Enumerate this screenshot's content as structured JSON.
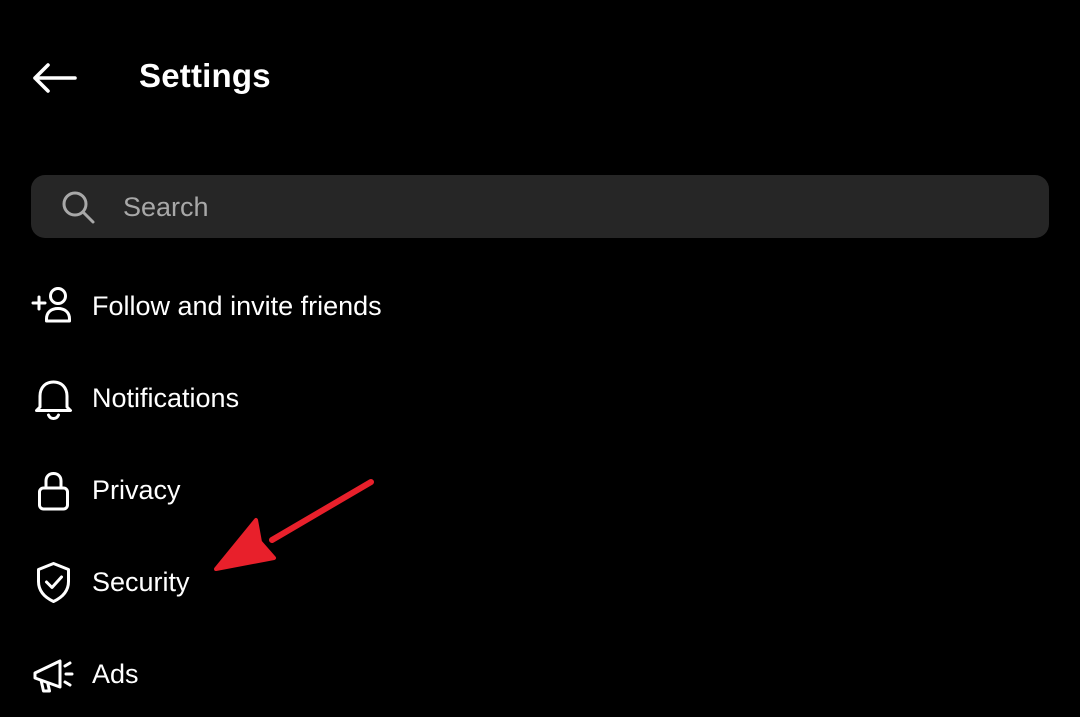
{
  "header": {
    "title": "Settings",
    "back_icon": "arrow-left-icon"
  },
  "search": {
    "placeholder": "Search",
    "value": "",
    "icon": "search-icon"
  },
  "menu": {
    "items": [
      {
        "label": "Follow and invite friends",
        "icon": "add-person-icon"
      },
      {
        "label": "Notifications",
        "icon": "bell-icon"
      },
      {
        "label": "Privacy",
        "icon": "lock-icon"
      },
      {
        "label": "Security",
        "icon": "shield-check-icon"
      },
      {
        "label": "Ads",
        "icon": "megaphone-icon"
      }
    ]
  },
  "annotation": {
    "type": "arrow-pointer",
    "target": "Security",
    "color": "#e8202b"
  },
  "colors": {
    "background": "#000000",
    "search_background": "#262626",
    "text": "#ffffff",
    "placeholder": "#a8a8a8"
  }
}
